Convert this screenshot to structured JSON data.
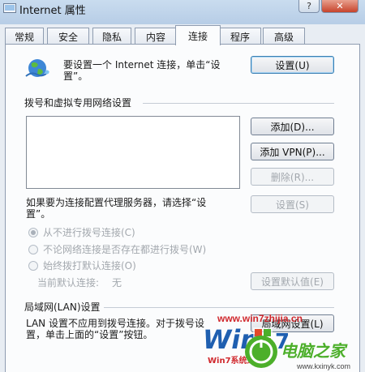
{
  "window": {
    "title": "Internet 属性",
    "help_label": "?",
    "close_label": "✕",
    "icon": "internet-options-icon"
  },
  "tabs": [
    "常规",
    "安全",
    "隐私",
    "内容",
    "连接",
    "程序",
    "高级"
  ],
  "active_tab": "连接",
  "connection_setup": {
    "line1": "要设置一个 Internet 连接，单击“设",
    "line2": "置”。",
    "button": "设置(U)",
    "icon": "globe-network-icon"
  },
  "dialup_vpn": {
    "heading": "拨号和虚拟专用网络设置",
    "add_button": "添加(D)...",
    "add_vpn_button": "添加 VPN(P)...",
    "remove_button": "删除(R)..."
  },
  "proxy": {
    "line1": "如果要为连接配置代理服务器，请选择“设",
    "line2": "置”。",
    "button": "设置(S)"
  },
  "dial_options": [
    {
      "label": "从不进行拨号连接(C)",
      "checked": true
    },
    {
      "label": "不论网络连接是否存在都进行拨号(W)",
      "checked": false
    },
    {
      "label": "始终拨打默认连接(O)",
      "checked": false
    }
  ],
  "default_connection": {
    "label": "当前默认连接:",
    "value": "无",
    "button": "设置默认值(E)"
  },
  "lan": {
    "heading": "局域网(LAN)设置",
    "line1": "LAN 设置不应用到拨号连接。对于拨号设",
    "line2": "置，单击上面的“设置”按钮。",
    "button": "局域网设置(L)"
  },
  "watermark": {
    "brand": "Win7系统之家",
    "url": "www.win7zhijia.cn",
    "corner_url": "www.kxinyk.com",
    "corner_brand": "电脑之家"
  },
  "colors": {
    "accent": "#3c7fb1",
    "watermark_red": "#d0282d",
    "watermark_blue": "#1f5fb0",
    "watermark_green": "#4caf2a"
  }
}
